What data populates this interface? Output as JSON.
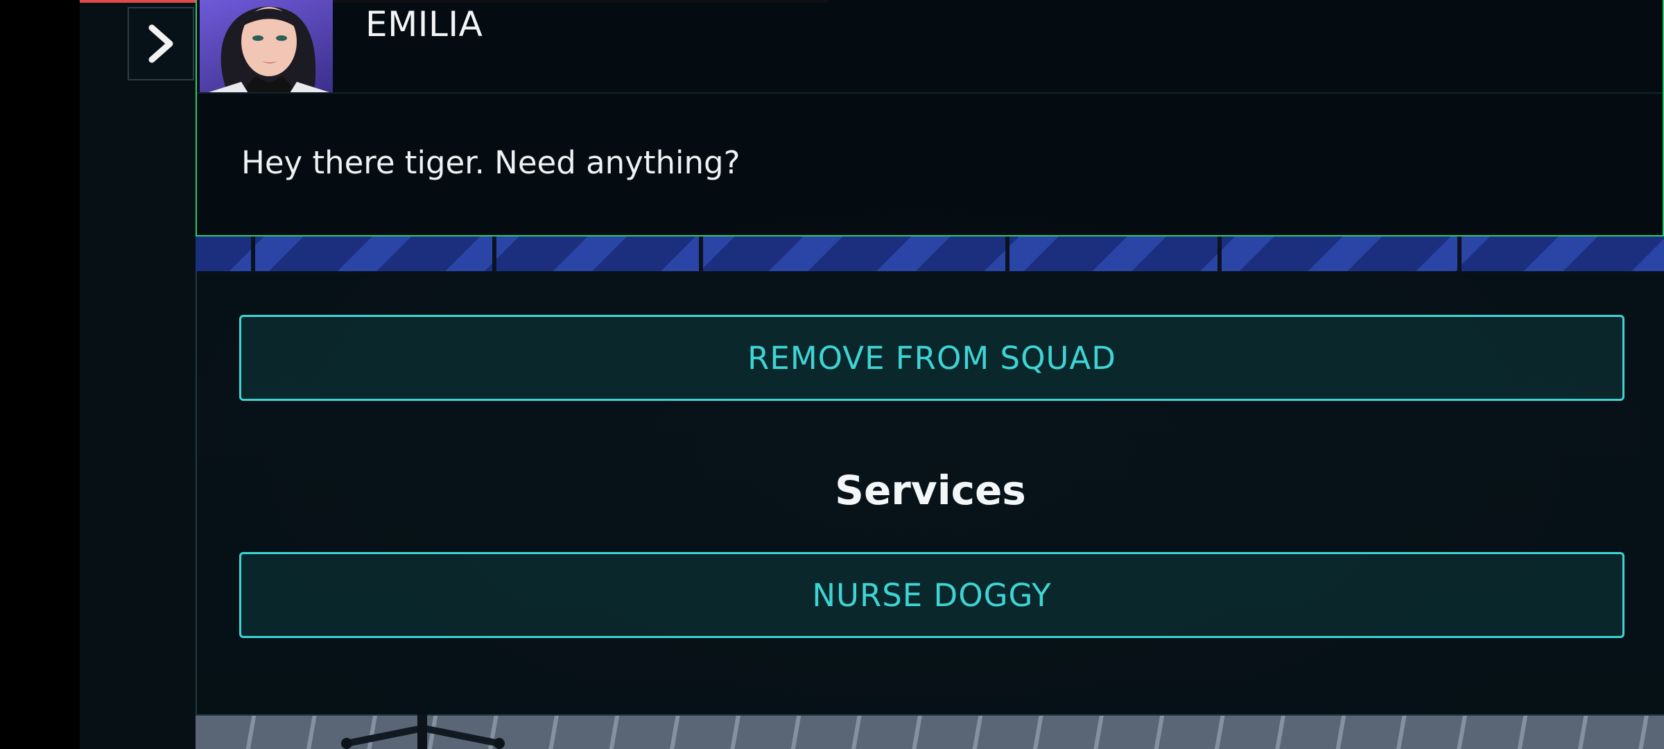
{
  "dialogue": {
    "speaker_name": "EMILIA",
    "line": "Hey there tiger. Need anything?"
  },
  "options": {
    "remove_label": "REMOVE FROM SQUAD",
    "services_title": "Services",
    "nurse_label": "NURSE DOGGY"
  },
  "icons": {
    "expand": "chevron-right-icon",
    "portrait": "character-portrait"
  },
  "colors": {
    "accent_teal": "#3fd4d4",
    "panel_border_green": "#2ecc71",
    "top_bar_red": "#e04a4a"
  }
}
